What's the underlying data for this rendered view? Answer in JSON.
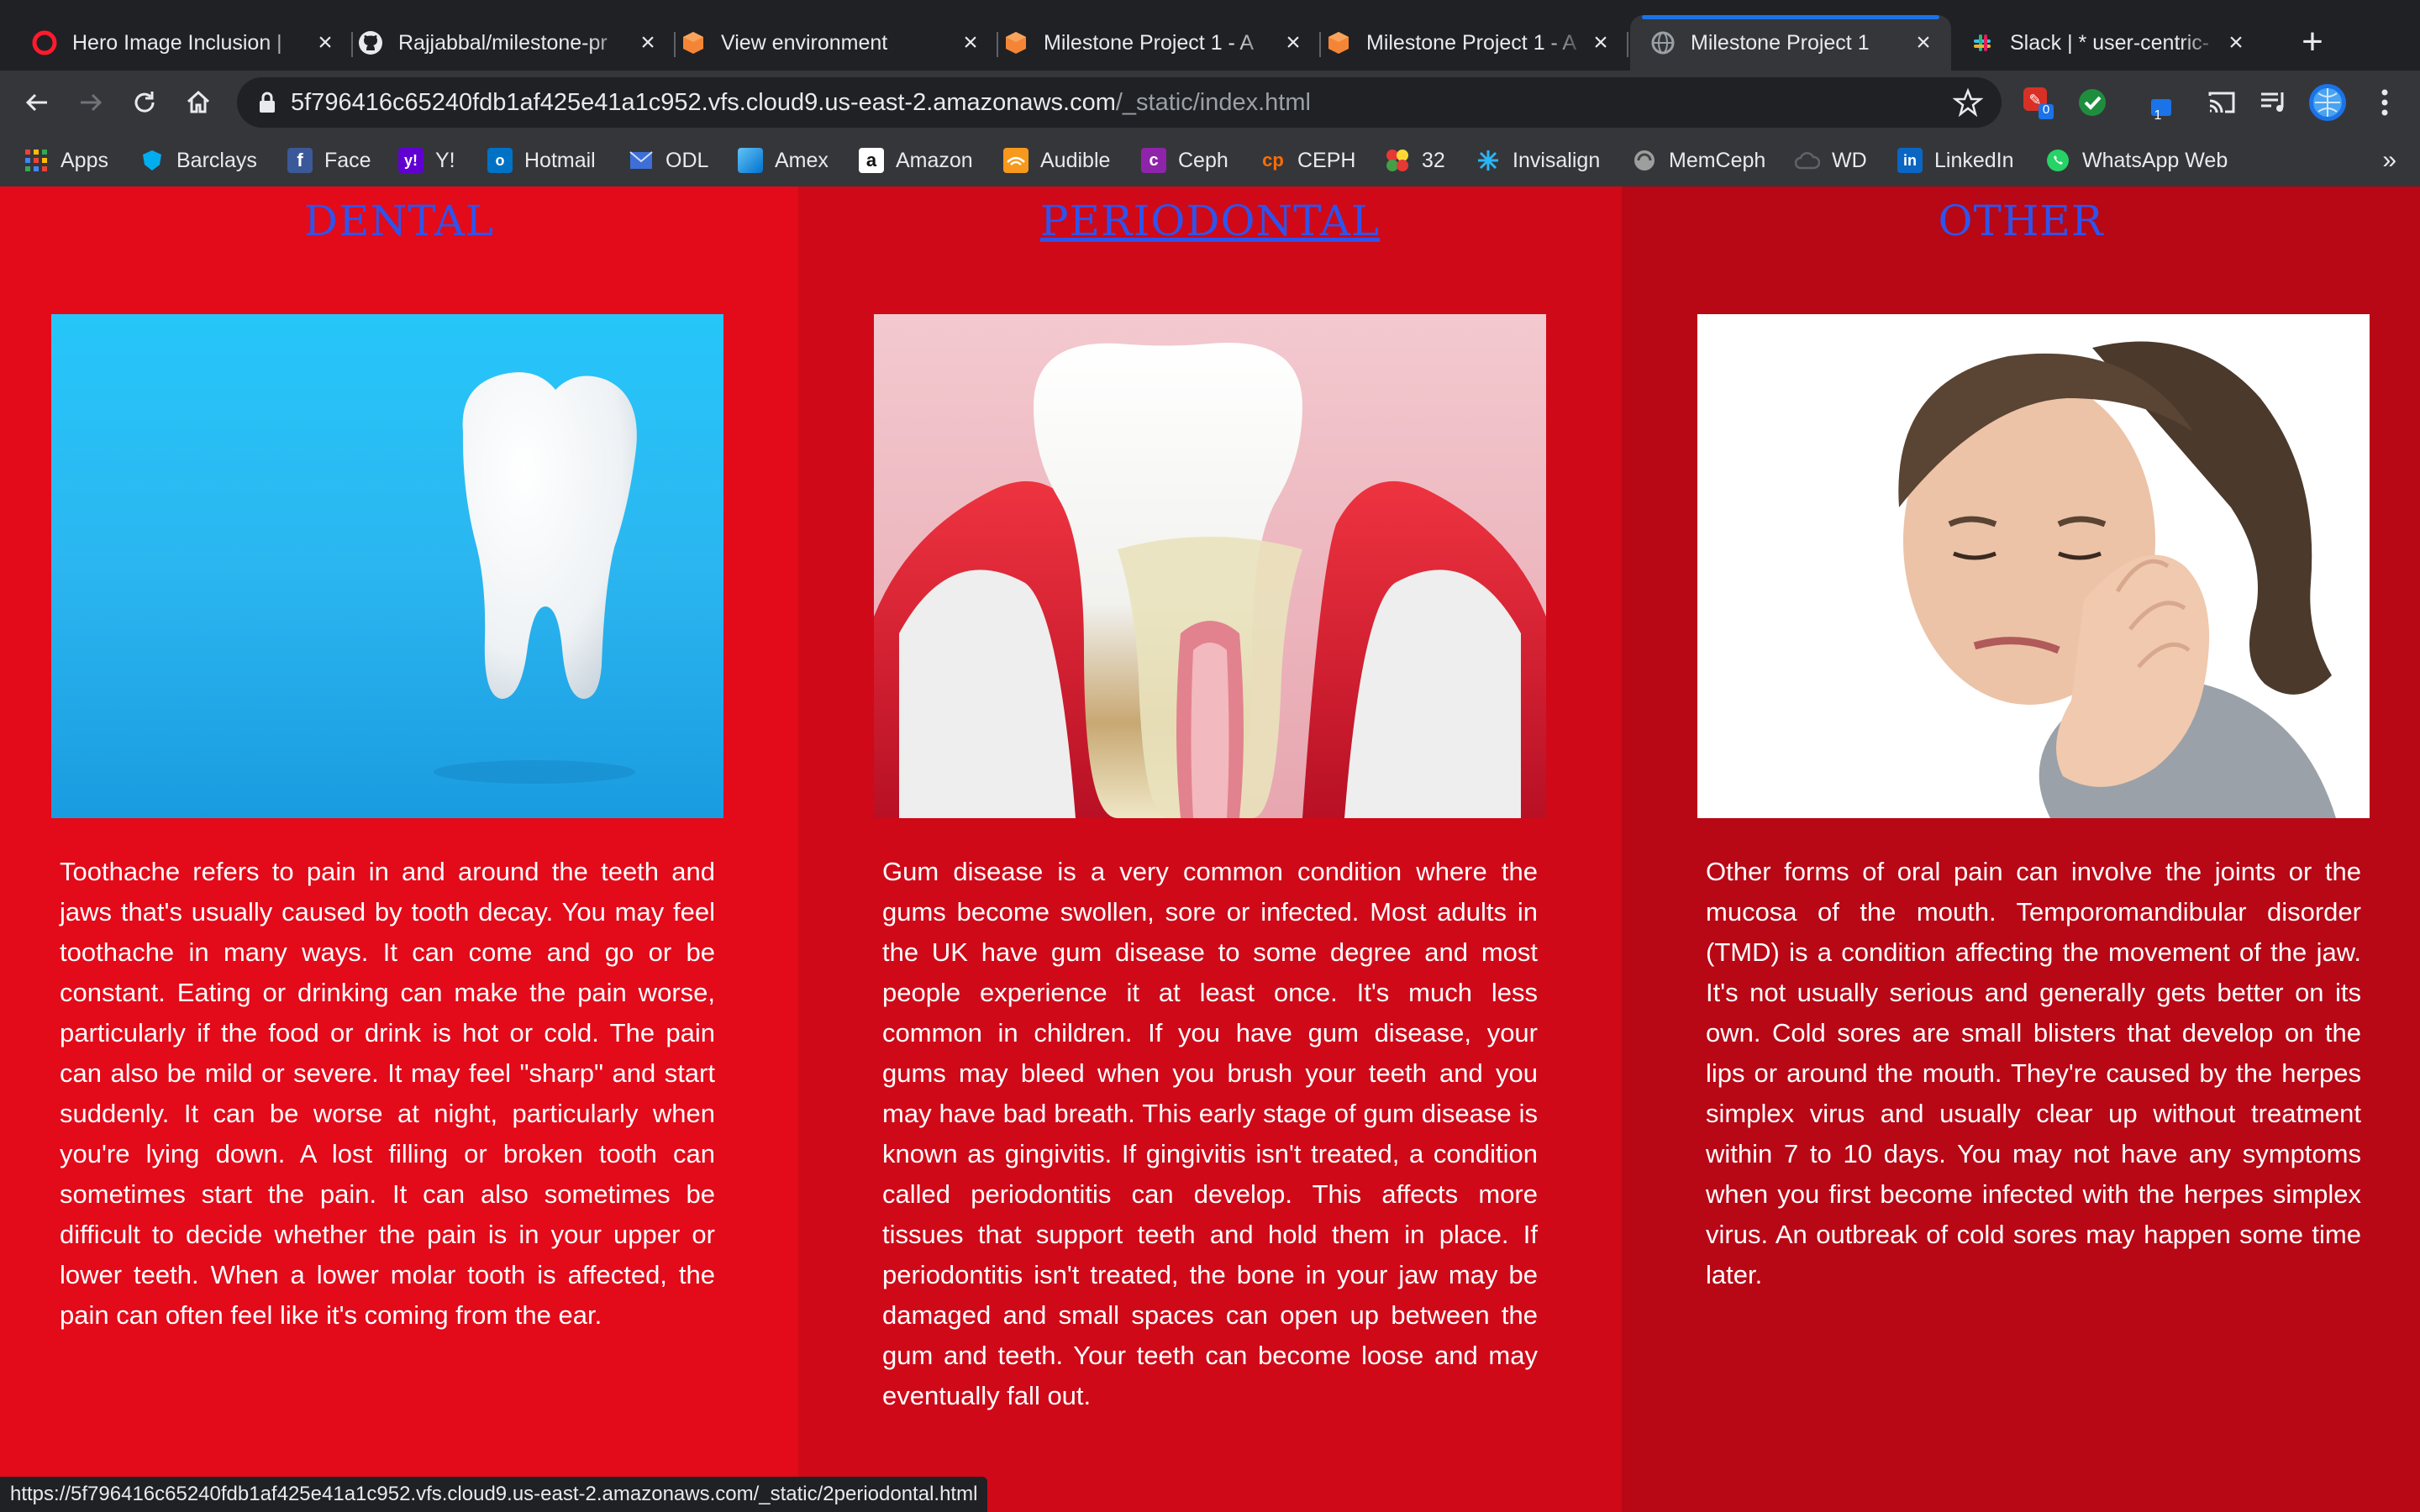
{
  "browser": {
    "tabs": [
      {
        "title": "Hero Image Inclusion |",
        "icon": "opera-icon",
        "active": false
      },
      {
        "title": "Rajjabbal/milestone-pr",
        "icon": "github-icon",
        "active": false
      },
      {
        "title": "View environment",
        "icon": "aws-cube-icon",
        "active": false
      },
      {
        "title": "Milestone Project 1 - A",
        "icon": "aws-cube-icon",
        "active": false
      },
      {
        "title": "Milestone Project 1 - A",
        "icon": "aws-cube-icon",
        "active": false
      },
      {
        "title": "Milestone Project 1",
        "icon": "globe-icon",
        "active": true
      },
      {
        "title": "Slack | * user-centric-",
        "icon": "slack-icon",
        "active": false
      }
    ],
    "address": {
      "host": "5f796416c65240fdb1af425e41a1c952.vfs.cloud9.us-east-2.amazonaws.com",
      "path": "/_static/index.html"
    },
    "extension_badges": {
      "first": "0",
      "third": "1"
    },
    "bookmarks": [
      {
        "label": "Apps",
        "icon": "apps-grid-icon"
      },
      {
        "label": "Barclays",
        "icon": "barclays-icon"
      },
      {
        "label": "Face",
        "icon": "facebook-icon"
      },
      {
        "label": "Y!",
        "icon": "yahoo-icon"
      },
      {
        "label": "Hotmail",
        "icon": "outlook-icon"
      },
      {
        "label": "ODL",
        "icon": "mail-icon"
      },
      {
        "label": "Amex",
        "icon": "amex-icon"
      },
      {
        "label": "Amazon",
        "icon": "amazon-icon"
      },
      {
        "label": "Audible",
        "icon": "audible-icon"
      },
      {
        "label": "Ceph",
        "icon": "ceph-icon"
      },
      {
        "label": "CEPH",
        "icon": "ceph-cp-icon"
      },
      {
        "label": "32",
        "icon": "flower-icon"
      },
      {
        "label": "Invisalign",
        "icon": "invisalign-icon"
      },
      {
        "label": "MemCeph",
        "icon": "memceph-icon"
      },
      {
        "label": "WD",
        "icon": "cloud-icon"
      },
      {
        "label": "LinkedIn",
        "icon": "linkedin-icon"
      },
      {
        "label": "WhatsApp Web",
        "icon": "whatsapp-icon"
      }
    ],
    "bookmarks_overflow": "»",
    "status_url": "https://5f796416c65240fdb1af425e41a1c952.vfs.cloud9.us-east-2.amazonaws.com/_static/2periodontal.html"
  },
  "columns": [
    {
      "heading": "DENTAL",
      "bg": "#e30a19",
      "image": "white-molar-tooth-on-blue-background",
      "text": "Toothache refers to pain in and around the teeth and jaws that's usually caused by tooth decay. You may feel toothache in many ways. It can come and go or be constant. Eating or drinking can make the pain worse, particularly if the food or drink is hot or cold. The pain can also be mild or severe. It may feel \"sharp\" and start suddenly. It can be worse at night, particularly when you're lying down. A lost filling or broken tooth can sometimes start the pain. It can also sometimes be difficult to decide whether the pain is in your upper or lower teeth. When a lower molar tooth is affected, the pain can often feel like it's coming from the ear."
    },
    {
      "heading": "PERIODONTAL",
      "bg": "#cf0918",
      "image": "tooth-with-inflamed-gums-cross-section",
      "text": "Gum disease is a very common condition where the gums become swollen, sore or infected. Most adults in the UK have gum disease to some degree and most people experience it at least once. It's much less common in children. If you have gum disease, your gums may bleed when you brush your teeth and you may have bad breath. This early stage of gum disease is known as gingivitis. If gingivitis isn't treated, a condition called periodontitis can develop. This affects more tissues that support teeth and hold them in place. If periodontitis isn't treated, the bone in your jaw may be damaged and small spaces can open up between the gum and teeth. Your teeth can become loose and may eventually fall out."
    },
    {
      "heading": "OTHER",
      "bg": "#b80715",
      "image": "woman-holding-jaw-in-pain",
      "text": "Other forms of oral pain can involve the joints or the mucosa of the mouth. Temporomandibular disorder (TMD) is a condition affecting the movement of the jaw. It's not usually serious and generally gets better on its own. Cold sores are small blisters that develop on the lips or around the mouth. They're caused by the herpes simplex virus and usually clear up without treatment within 7 to 10 days. You may not have any symptoms when you first become infected with the herpes simplex virus. An outbreak of cold sores may happen some time later."
    }
  ],
  "colors": {
    "heading": "#2f54eb",
    "chrome_dark": "#202124",
    "chrome_toolbar": "#35363a",
    "active_tab_accent": "#1a73e8"
  }
}
